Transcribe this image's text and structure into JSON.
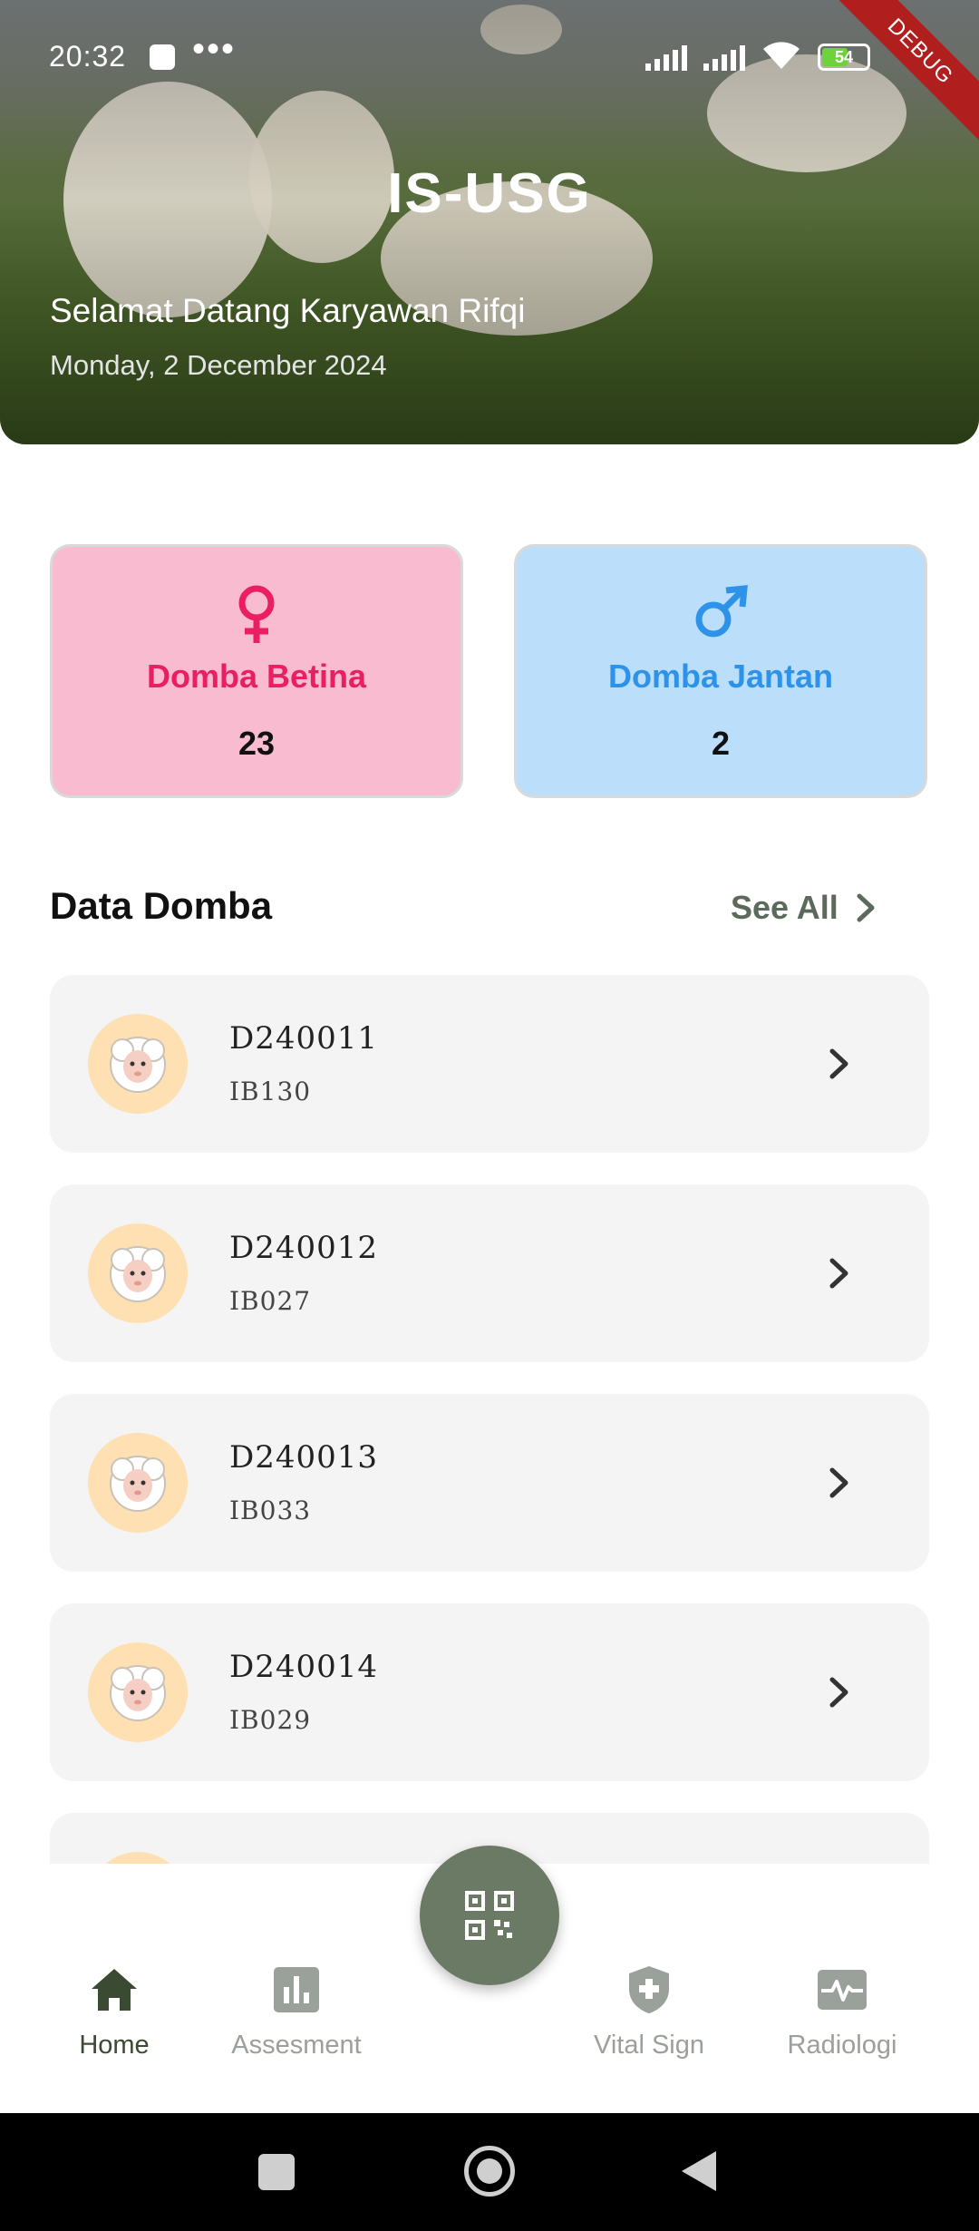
{
  "status_bar": {
    "time": "20:32",
    "more_glyph": "•••",
    "battery": "54",
    "debug_label": "DEBUG"
  },
  "header": {
    "title": "IS-USG",
    "greeting": "Selamat Datang Karyawan Rifqi",
    "date": "Monday, 2 December 2024"
  },
  "stats": {
    "female": {
      "label": "Domba Betina",
      "value": "23",
      "icon": "female-icon",
      "color": "#e91e63",
      "bg": "#f8bbd0"
    },
    "male": {
      "label": "Domba Jantan",
      "value": "2",
      "icon": "male-icon",
      "color": "#2e93e8",
      "bg": "#bbdefb"
    }
  },
  "section": {
    "title": "Data Domba",
    "see_all": "See All"
  },
  "sheep_list": [
    {
      "id": "D240011",
      "code": "IB130"
    },
    {
      "id": "D240012",
      "code": "IB027"
    },
    {
      "id": "D240013",
      "code": "IB033"
    },
    {
      "id": "D240014",
      "code": "IB029"
    }
  ],
  "bottom_nav": {
    "home": "Home",
    "assesment": "Assesment",
    "vital_sign": "Vital Sign",
    "radiologi": "Radiologi",
    "fab_icon": "qr-scan-icon",
    "active": "home"
  },
  "colors": {
    "primary": "#6b7a65",
    "active_nav": "#3b4a33",
    "inactive_nav": "#9aa09a"
  }
}
